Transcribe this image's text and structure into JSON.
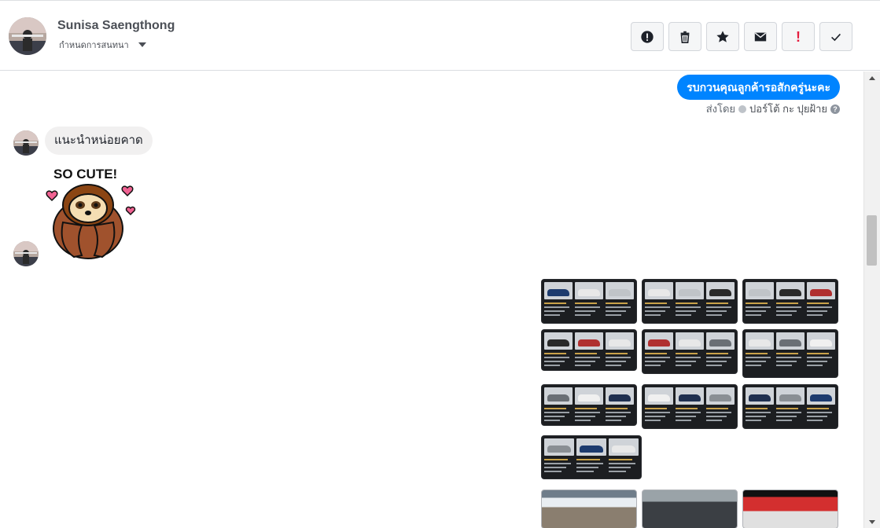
{
  "header": {
    "contact_name": "Sunisa Saengthong",
    "subtitle": "กำหนดการสนทนา",
    "actions": [
      {
        "name": "report-spam",
        "icon": "exclamation-circle-icon"
      },
      {
        "name": "delete",
        "icon": "trash-icon"
      },
      {
        "name": "star",
        "icon": "star-icon"
      },
      {
        "name": "mark-unread",
        "icon": "envelope-icon"
      },
      {
        "name": "important",
        "icon": "red-exclamation-icon",
        "label": "!"
      },
      {
        "name": "done",
        "icon": "checkmark-icon"
      }
    ]
  },
  "messages": {
    "outgoing_text": "รบกวนคุณลูกค้ารอสักครู่นะคะ",
    "sent_by_label": "ส่งโดย",
    "sent_by_name": "ปอร์โต้ กะ ปุยฝ้าย",
    "help_glyph": "?",
    "incoming_text": "แนะนำหน่อยคาด",
    "sticker_text": "SO CUTE!"
  },
  "image_grid": {
    "thumbnail_count": 10,
    "photo_count": 3
  },
  "colors": {
    "brand_blue": "#0084ff",
    "important_red": "#e41e3f",
    "thumb_bg": "#1c1e21"
  }
}
